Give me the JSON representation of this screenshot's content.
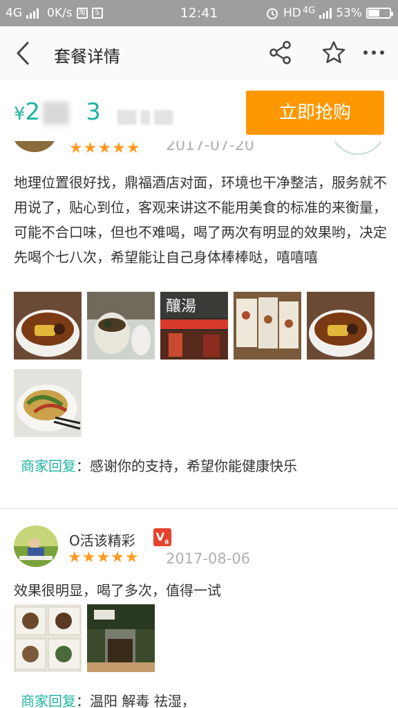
{
  "status_bar": {
    "network": "4G",
    "speed": "0K/s",
    "time": "12:41",
    "hd": "HD",
    "network2": "4G",
    "battery": "53%",
    "battery_level": 0.53
  },
  "nav": {
    "title": "套餐详情"
  },
  "purchase": {
    "currency": "¥",
    "price_partial": "2",
    "price_tail": "3",
    "buy_label": "立即抢购"
  },
  "review1": {
    "rating": "★★★★★",
    "date": "2017-07-20",
    "text": "地理位置很好找，鼎福酒店对面，环境也干净整洁，服务就不用说了，贴心到位，客观来讲这不能用美食的标准的来衡量，可能不合口味，但也不难喝，喝了两次有明显的效果哟，决定先喝个七八次，希望能让自己身体棒棒哒，嘻嘻嘻",
    "photo3_sign": "釀湯",
    "reply_label": "商家回复",
    "reply_sep": "：",
    "reply_text": "感谢你的支持，希望你能健康快乐"
  },
  "review2": {
    "username": "O活该精彩",
    "vip": "V",
    "vip_level": "6",
    "rating": "★★★★★",
    "date": "2017-08-06",
    "text": "效果很明显，喝了多次，值得一试",
    "reply_label": "商家回复",
    "reply_sep": "：",
    "reply_text": "温阳 解毒 祛湿，"
  },
  "colors": {
    "accent": "#20b2a2",
    "buy_button": "#ff9800",
    "star": "#ff9a1f"
  }
}
